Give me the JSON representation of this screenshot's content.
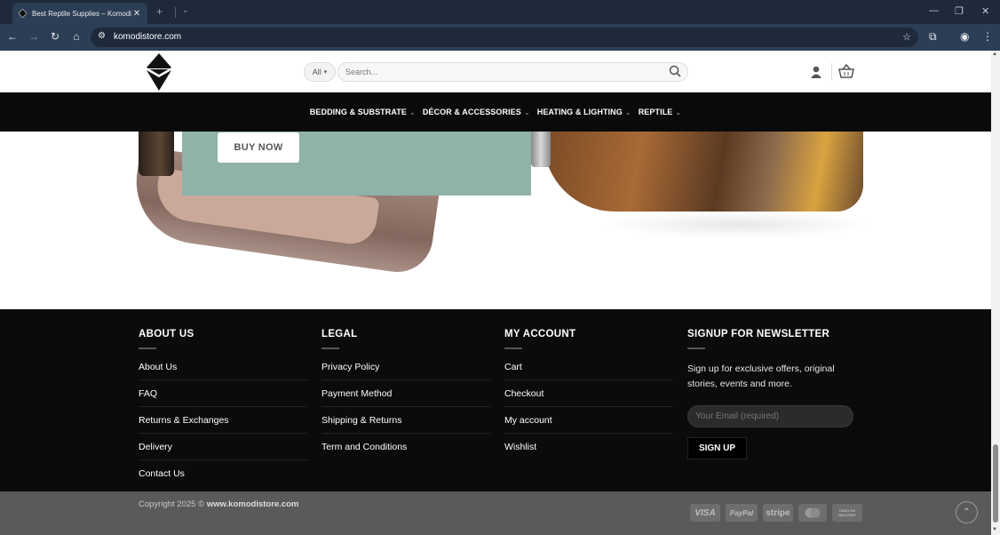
{
  "browser": {
    "tab_title": "Best Reptile Supplies – Komodi",
    "url": "komodistore.com",
    "icons": {
      "favicon": "komodi-logo-icon",
      "close_tab": "close-icon",
      "new_tab": "plus-icon",
      "tab_menu": "chevron-down-icon",
      "back": "arrow-left-icon",
      "forward": "arrow-right-icon",
      "reload": "reload-icon",
      "home": "home-icon",
      "site_info": "tune-icon",
      "bookmark": "star-icon",
      "extensions": "puzzle-icon",
      "profile": "profile-icon",
      "menu": "kebab-menu-icon"
    }
  },
  "header": {
    "category_select": "All",
    "search_placeholder": "Search...",
    "icons": {
      "logo": "komodi-logo-icon",
      "search": "search-icon",
      "account": "account-icon",
      "cart": "basket-icon"
    }
  },
  "nav": {
    "items": [
      {
        "label": "BEDDING & SUBSTRATE"
      },
      {
        "label": "DÉCOR & ACCESSORIES"
      },
      {
        "label": "HEATING & LIGHTING"
      },
      {
        "label": "REPTILE"
      }
    ]
  },
  "hero": {
    "cta_label": "BUY NOW"
  },
  "footer": {
    "about": {
      "heading": "ABOUT US",
      "links": [
        "About Us",
        "FAQ",
        "Returns & Exchanges",
        "Delivery",
        "Contact Us"
      ]
    },
    "legal": {
      "heading": "LEGAL",
      "links": [
        "Privacy Policy",
        "Payment Method",
        "Shipping & Returns",
        "Term and Conditions"
      ]
    },
    "account": {
      "heading": "MY ACCOUNT",
      "links": [
        "Cart",
        "Checkout",
        "My account",
        "Wishlist"
      ]
    },
    "newsletter": {
      "heading": "SIGNUP FOR NEWSLETTER",
      "text": "Sign up for exclusive offers, original stories, events and more.",
      "email_placeholder": "Your Email (required)",
      "button_label": "SIGN UP"
    }
  },
  "footer_bottom": {
    "copyright_prefix": "Copyright 2025 © ",
    "copyright_site": "www.komodistore.com",
    "payments": [
      "VISA",
      "PayPal",
      "stripe",
      "mastercard",
      "CASH ON DELIVERY"
    ]
  },
  "colors": {
    "nav_bg": "#0a0a0a",
    "hero_panel": "#8fb3a8",
    "footer_bg": "#0b0b0b",
    "footer_bottom_bg": "#5a5a5a"
  }
}
